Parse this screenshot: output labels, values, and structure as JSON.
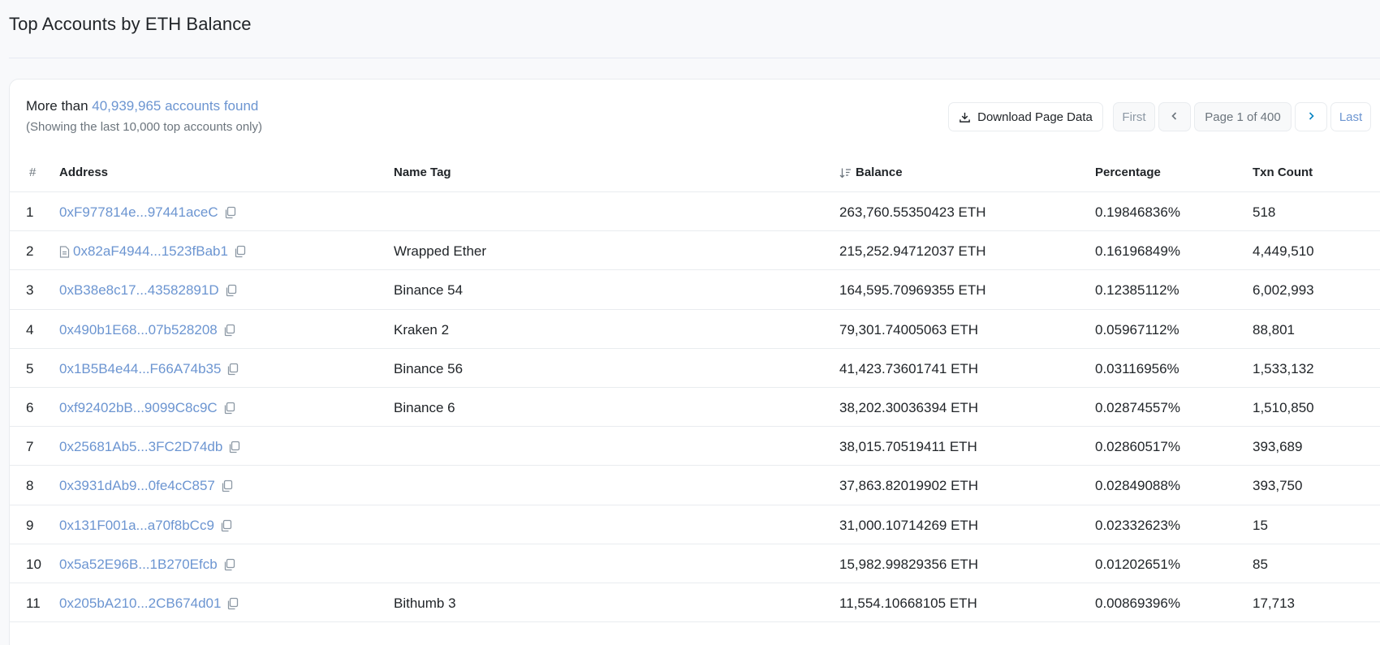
{
  "header": {
    "title": "Top Accounts by ETH Balance"
  },
  "summary": {
    "prefix": "More than ",
    "link_text": "40,939,965 accounts found",
    "sub": "(Showing the last 10,000 top accounts only)"
  },
  "toolbar": {
    "download_label": "Download Page Data",
    "first_label": "First",
    "page_label": "Page 1 of 400",
    "last_label": "Last",
    "download_icon": "download-icon",
    "prev_icon": "chevron-left-icon",
    "next_icon": "chevron-right-icon"
  },
  "table": {
    "columns": {
      "rank": "#",
      "address": "Address",
      "name_tag": "Name Tag",
      "balance": "Balance",
      "percentage": "Percentage",
      "txn_count": "Txn Count"
    },
    "rows": [
      {
        "rank": "1",
        "address": "0xF977814e...97441aceC",
        "contract": false,
        "name_tag": "",
        "balance": "263,760.55350423 ETH",
        "percentage": "0.19846836%",
        "txn_count": "518"
      },
      {
        "rank": "2",
        "address": "0x82aF4944...1523fBab1",
        "contract": true,
        "name_tag": "Wrapped Ether",
        "balance": "215,252.94712037 ETH",
        "percentage": "0.16196849%",
        "txn_count": "4,449,510"
      },
      {
        "rank": "3",
        "address": "0xB38e8c17...43582891D",
        "contract": false,
        "name_tag": "Binance 54",
        "balance": "164,595.70969355 ETH",
        "percentage": "0.12385112%",
        "txn_count": "6,002,993"
      },
      {
        "rank": "4",
        "address": "0x490b1E68...07b528208",
        "contract": false,
        "name_tag": "Kraken 2",
        "balance": "79,301.74005063 ETH",
        "percentage": "0.05967112%",
        "txn_count": "88,801"
      },
      {
        "rank": "5",
        "address": "0x1B5B4e44...F66A74b35",
        "contract": false,
        "name_tag": "Binance 56",
        "balance": "41,423.73601741 ETH",
        "percentage": "0.03116956%",
        "txn_count": "1,533,132"
      },
      {
        "rank": "6",
        "address": "0xf92402bB...9099C8c9C",
        "contract": false,
        "name_tag": "Binance 6",
        "balance": "38,202.30036394 ETH",
        "percentage": "0.02874557%",
        "txn_count": "1,510,850"
      },
      {
        "rank": "7",
        "address": "0x25681Ab5...3FC2D74db",
        "contract": false,
        "name_tag": "",
        "balance": "38,015.70519411 ETH",
        "percentage": "0.02860517%",
        "txn_count": "393,689"
      },
      {
        "rank": "8",
        "address": "0x3931dAb9...0fe4cC857",
        "contract": false,
        "name_tag": "",
        "balance": "37,863.82019902 ETH",
        "percentage": "0.02849088%",
        "txn_count": "393,750"
      },
      {
        "rank": "9",
        "address": "0x131F001a...a70f8bCc9",
        "contract": false,
        "name_tag": "",
        "balance": "31,000.10714269 ETH",
        "percentage": "0.02332623%",
        "txn_count": "15"
      },
      {
        "rank": "10",
        "address": "0x5a52E96B...1B270Efcb",
        "contract": false,
        "name_tag": "",
        "balance": "15,982.99829356 ETH",
        "percentage": "0.01202651%",
        "txn_count": "85"
      },
      {
        "rank": "11",
        "address": "0x205bA210...2CB674d01",
        "contract": false,
        "name_tag": "Bithumb 3",
        "balance": "11,554.10668105 ETH",
        "percentage": "0.00869396%",
        "txn_count": "17,713"
      }
    ]
  },
  "colors": {
    "link": "#6c95d1",
    "text": "#212529",
    "muted": "#6c757d",
    "border": "#e9ecef"
  }
}
